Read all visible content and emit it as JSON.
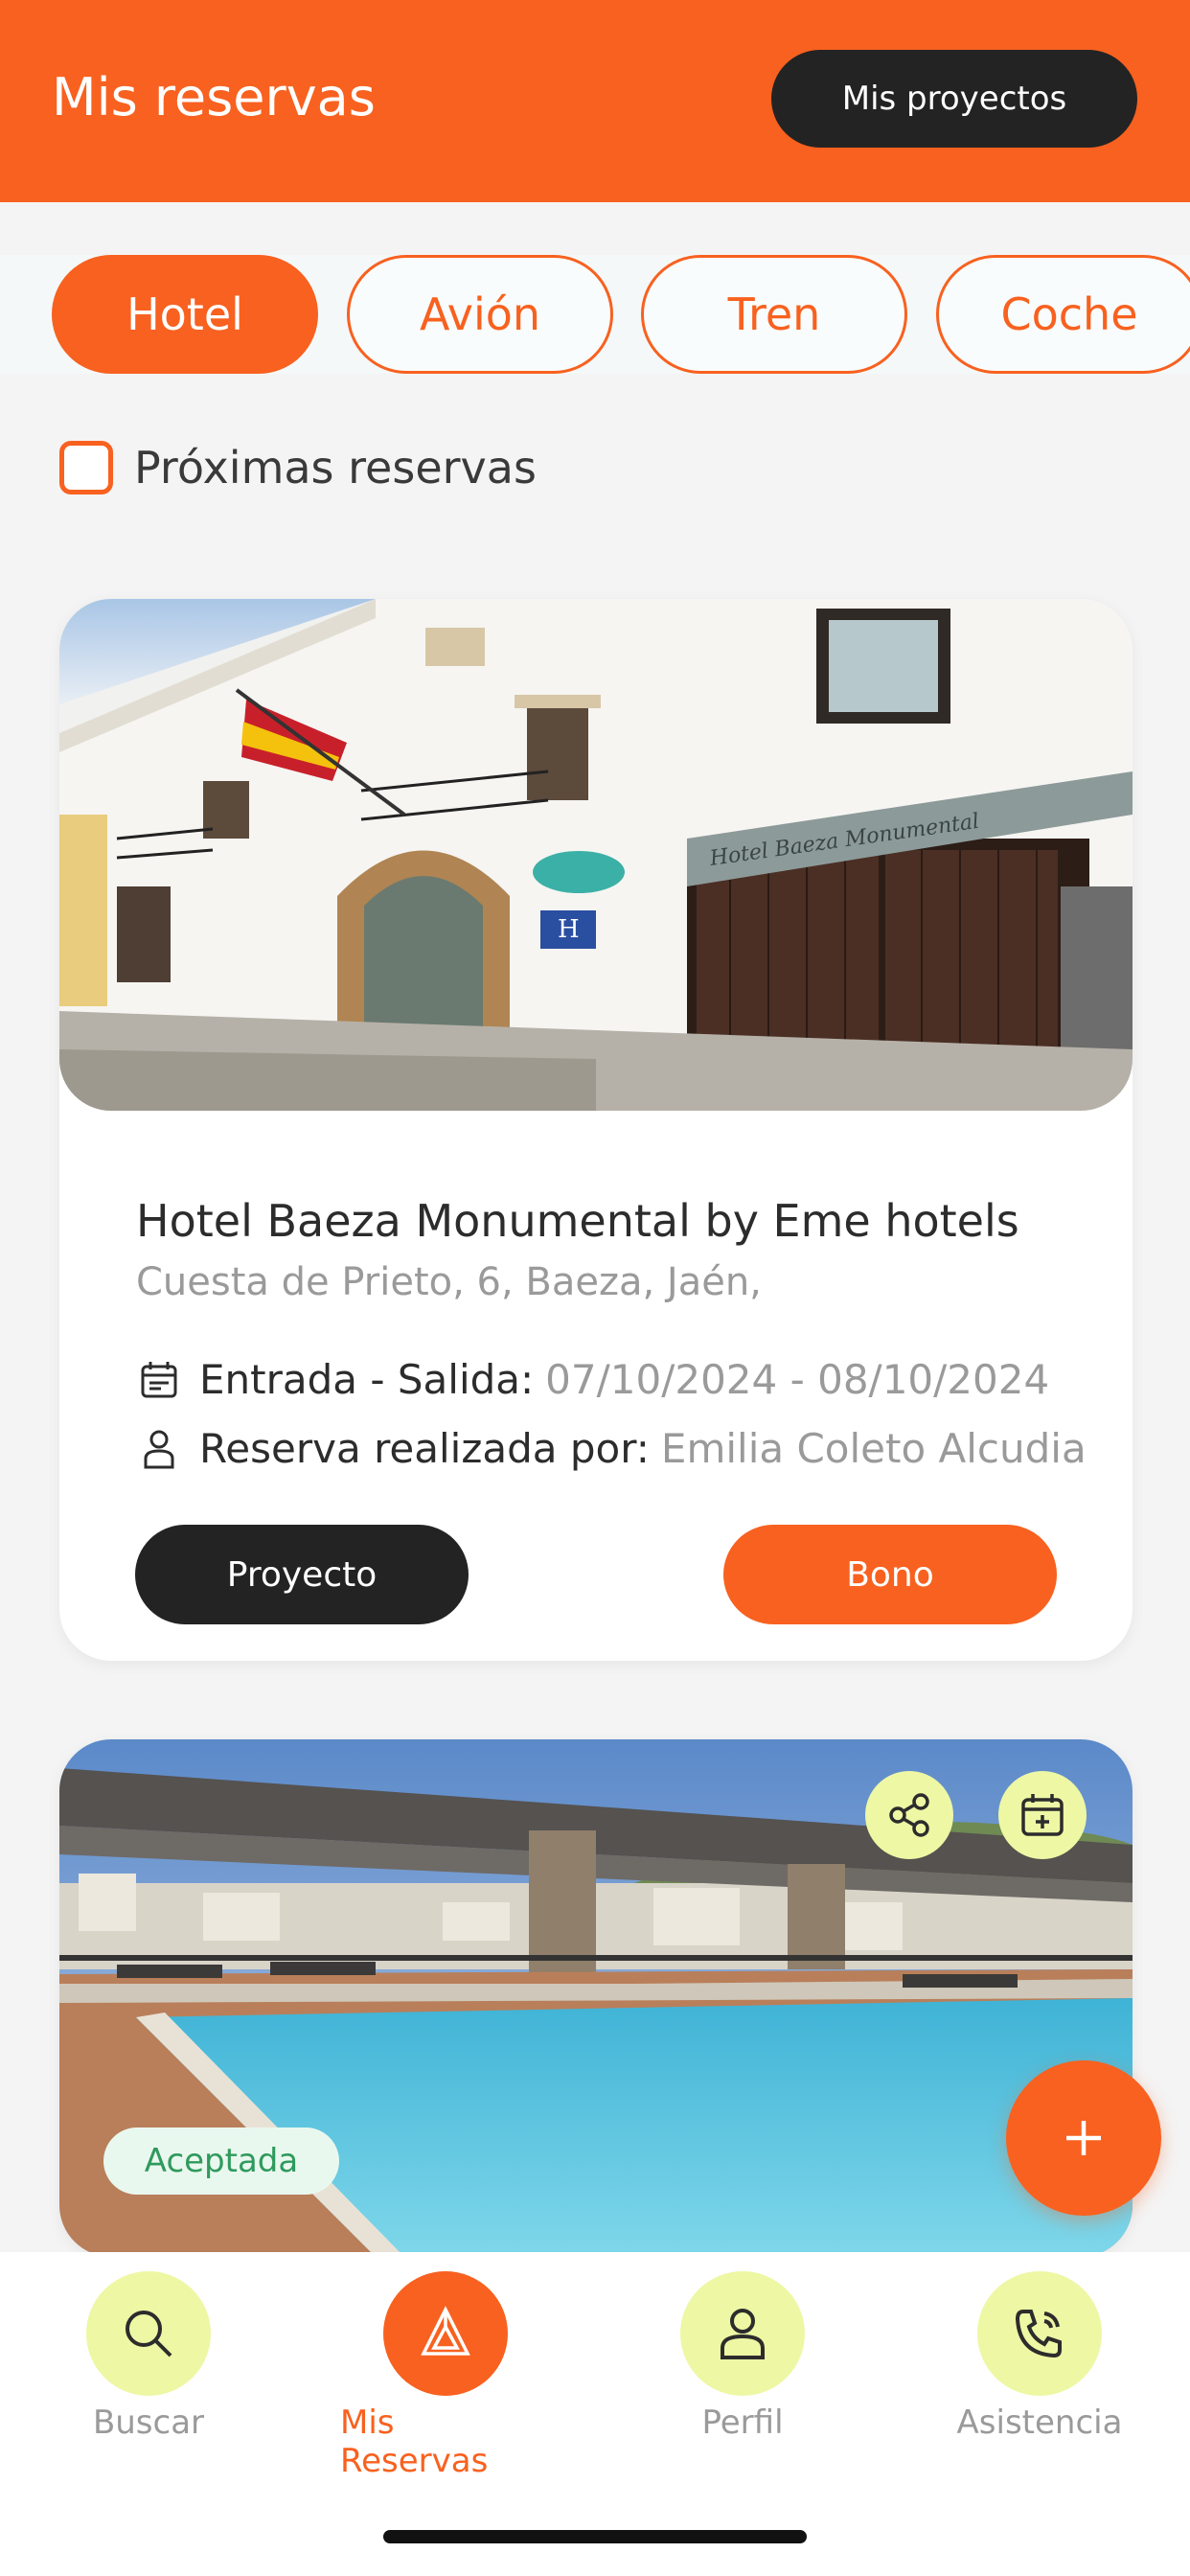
{
  "header": {
    "title": "Mis reservas",
    "projects_button": "Mis proyectos"
  },
  "tabs": [
    {
      "label": "Hotel",
      "active": true
    },
    {
      "label": "Avión",
      "active": false
    },
    {
      "label": "Tren",
      "active": false
    },
    {
      "label": "Coche",
      "active": false
    }
  ],
  "filter": {
    "label": "Próximas reservas",
    "checked": false
  },
  "reservations": [
    {
      "name": "Hotel Baeza Monumental by Eme hotels",
      "address": "Cuesta de Prieto, 6, Baeza, Jaén,",
      "dates_label": "Entrada - Salida:",
      "dates_value": "07/10/2024 - 08/10/2024",
      "booked_by_label": "Reserva realizada por:",
      "booked_by_value": "Emilia Coleto Alcudia",
      "project_button": "Proyecto",
      "voucher_button": "Bono",
      "image_sign_text": "Hotel Baeza Monumental"
    },
    {
      "status": "Aceptada"
    }
  ],
  "bottom_nav": [
    {
      "label": "Buscar",
      "icon": "search-icon",
      "active": false
    },
    {
      "label": "Mis Reservas",
      "icon": "reservations-icon",
      "active": true
    },
    {
      "label": "Perfil",
      "icon": "user-icon",
      "active": false
    },
    {
      "label": "Asistencia",
      "icon": "phone-icon",
      "active": false
    }
  ],
  "colors": {
    "accent": "#f8611f",
    "dark": "#232323",
    "nav_circle": "#eef7a4",
    "badge_text": "#2f9a5c"
  }
}
